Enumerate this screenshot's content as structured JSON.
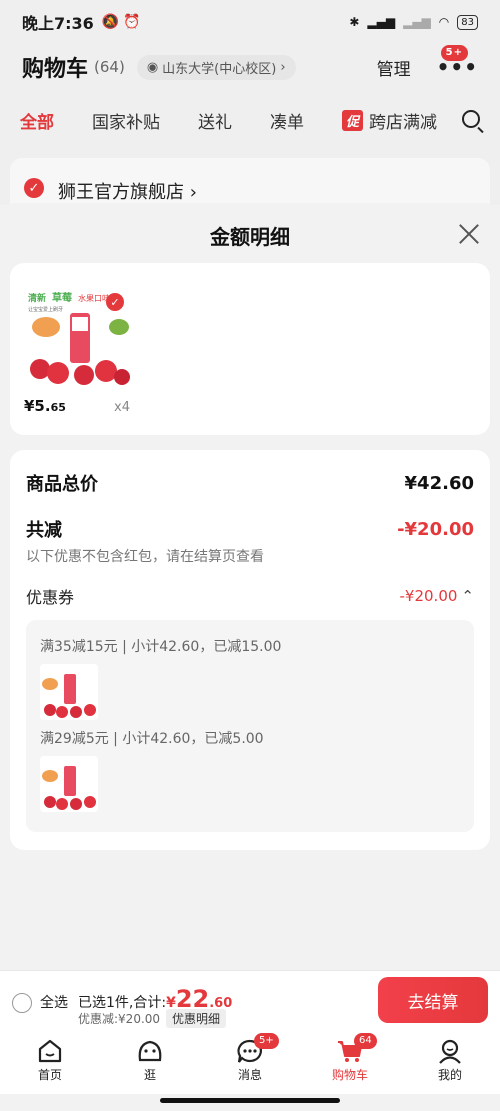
{
  "status_bar": {
    "time": "晚上7:36",
    "battery": "83"
  },
  "header": {
    "title": "购物车",
    "count": "(64)",
    "location": "山东大学(中心校区)",
    "manage": "管理",
    "more_badge": "5+"
  },
  "tabs": [
    "全部",
    "国家补贴",
    "送礼",
    "凑单"
  ],
  "promo_tab": {
    "tag": "促",
    "label": "跨店满减"
  },
  "store": {
    "name": "狮王官方旗舰店"
  },
  "sheet": {
    "title": "金额明细",
    "product": {
      "price_main": "¥5.",
      "price_cents": "65",
      "qty": "x4",
      "img_text": {
        "line1_a": "清新",
        "line1_b": "草莓",
        "line1_c": "水果口味",
        "line2": "让宝宝爱上刷牙"
      }
    },
    "goods_total_label": "商品总价",
    "goods_total_value": "¥42.60",
    "reduce_label": "共减",
    "reduce_value": "-¥20.00",
    "reduce_note": "以下优惠不包含红包，请在结算页查看",
    "coupon_label": "优惠券",
    "coupon_value": "-¥20.00",
    "coupon_lines": [
      "满35减15元 | 小计42.60，已减15.00",
      "满29减5元 | 小计42.60，已减5.00"
    ]
  },
  "bottom_bar": {
    "select_all": "全选",
    "selected_text": "已选1件,合计:",
    "currency": "¥",
    "total_int": "22",
    "total_dec": ".60",
    "discount_text": "优惠减:¥20.00",
    "detail_btn": "优惠明细",
    "checkout": "去结算"
  },
  "nav": [
    {
      "label": "首页",
      "icon": "home-icon"
    },
    {
      "label": "逛",
      "icon": "stroll-icon"
    },
    {
      "label": "消息",
      "icon": "message-icon",
      "badge": "5+"
    },
    {
      "label": "购物车",
      "icon": "cart-icon",
      "badge": "64",
      "active": true
    },
    {
      "label": "我的",
      "icon": "profile-icon"
    }
  ],
  "colors": {
    "accent": "#e4393c",
    "background": "#f2f2f2"
  }
}
